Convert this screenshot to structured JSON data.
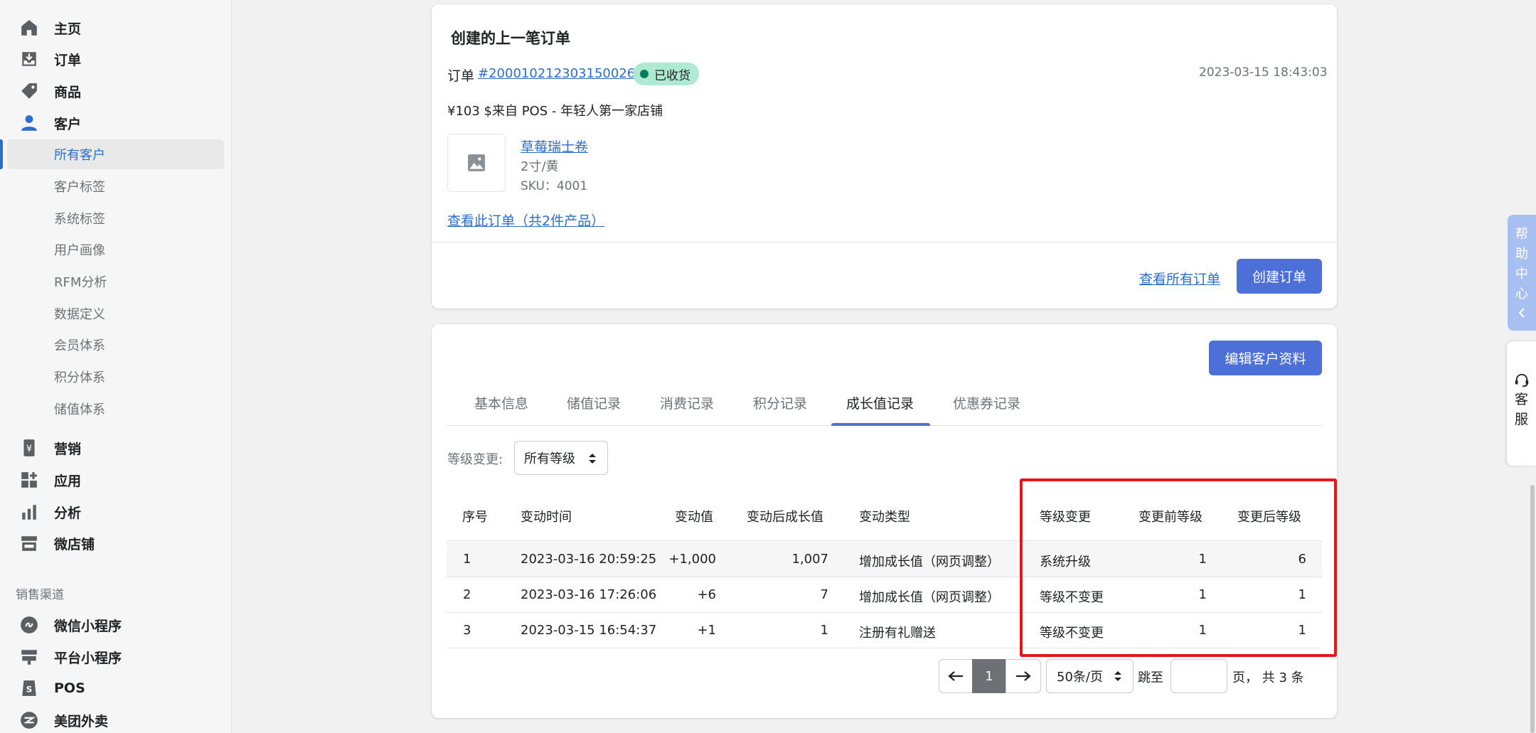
{
  "sidebar": {
    "nav": [
      {
        "label": "主页",
        "icon": "home-icon"
      },
      {
        "label": "订单",
        "icon": "orders-icon"
      },
      {
        "label": "商品",
        "icon": "tag-icon"
      },
      {
        "label": "客户",
        "icon": "customer-icon"
      }
    ],
    "sub": [
      "所有客户",
      "客户标签",
      "系统标签",
      "用户画像",
      "RFM分析",
      "数据定义",
      "会员体系",
      "积分体系",
      "储值体系"
    ],
    "nav2": [
      {
        "label": "营销",
        "icon": "marketing-icon"
      },
      {
        "label": "应用",
        "icon": "apps-icon"
      },
      {
        "label": "分析",
        "icon": "analytics-icon"
      },
      {
        "label": "微店铺",
        "icon": "store-icon"
      }
    ],
    "section_label": "销售渠道",
    "channels": [
      {
        "label": "微信小程序",
        "icon": "wechat-miniprogram-icon"
      },
      {
        "label": "平台小程序",
        "icon": "platform-miniprogram-icon"
      },
      {
        "label": "POS",
        "icon": "pos-icon"
      },
      {
        "label": "美团外卖",
        "icon": "meituan-icon"
      }
    ]
  },
  "last_order": {
    "title": "创建的上一笔订单",
    "order_prefix": "订单",
    "order_number": "#200010212303150026",
    "status": "已收货",
    "date": "2023-03-15 18:43:03",
    "summary": "¥103 $来自 POS - 年轻人第一家店铺",
    "product_name": "草莓瑞士卷",
    "product_variant": "2寸/黄",
    "product_sku": "SKU：4001",
    "view_order_link": "查看此订单（共2件产品）",
    "view_all_orders": "查看所有订单",
    "create_order": "创建订单"
  },
  "customer": {
    "edit_button": "编辑客户资料",
    "tabs": [
      "基本信息",
      "储值记录",
      "消费记录",
      "积分记录",
      "成长值记录",
      "优惠券记录"
    ],
    "active_tab": "成长值记录",
    "filter_label": "等级变更:",
    "filter_value": "所有等级",
    "table": {
      "headers": [
        "序号",
        "变动时间",
        "变动值",
        "变动后成长值",
        "变动类型",
        "等级变更",
        "变更前等级",
        "变更后等级"
      ],
      "rows": [
        [
          "1",
          "2023-03-16 20:59:25",
          "+1,000",
          "1,007",
          "增加成长值（网页调整）",
          "系统升级",
          "1",
          "6"
        ],
        [
          "2",
          "2023-03-16 17:26:06",
          "+6",
          "7",
          "增加成长值（网页调整）",
          "等级不变更",
          "1",
          "1"
        ],
        [
          "3",
          "2023-03-15 16:54:37",
          "+1",
          "1",
          "注册有礼赠送",
          "等级不变更",
          "1",
          "1"
        ]
      ]
    },
    "pagination": {
      "current_page": "1",
      "page_size": "50条/页",
      "jump_label": "跳至",
      "total_text": "页， 共 3 条"
    }
  },
  "floating": {
    "help": [
      "帮",
      "助",
      "中",
      "心"
    ],
    "service": [
      "客",
      "服"
    ]
  },
  "colors": {
    "accent": "#4c6fd8",
    "link": "#2c6ecb",
    "badge_bg": "#aee9d1",
    "highlight": "#e8141b"
  }
}
